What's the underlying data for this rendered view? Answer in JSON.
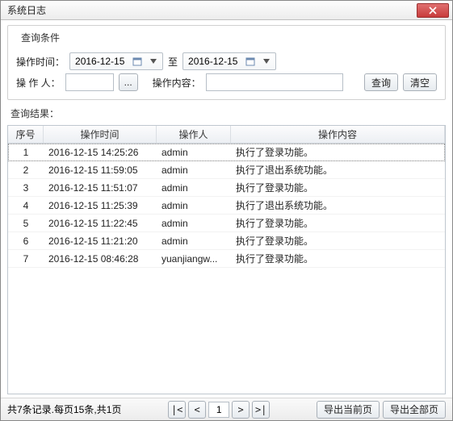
{
  "window": {
    "title": "系统日志"
  },
  "query": {
    "legend": "查询条件",
    "time_label": "操作时间：",
    "to_label": "至",
    "date_from": "2016-12-15",
    "date_to": "2016-12-15",
    "operator_label": "操 作 人：",
    "operator_value": "",
    "content_label": "操作内容：",
    "content_value": "",
    "search_btn": "查询",
    "clear_btn": "清空",
    "ellipsis": "..."
  },
  "result": {
    "label": "查询结果：",
    "columns": {
      "idx": "序号",
      "time": "操作时间",
      "user": "操作人",
      "content": "操作内容"
    },
    "rows": [
      {
        "idx": "1",
        "time": "2016-12-15 14:25:26",
        "user": "admin",
        "content": "执行了登录功能。"
      },
      {
        "idx": "2",
        "time": "2016-12-15 11:59:05",
        "user": "admin",
        "content": "执行了退出系统功能。"
      },
      {
        "idx": "3",
        "time": "2016-12-15 11:51:07",
        "user": "admin",
        "content": "执行了登录功能。"
      },
      {
        "idx": "4",
        "time": "2016-12-15 11:25:39",
        "user": "admin",
        "content": "执行了退出系统功能。"
      },
      {
        "idx": "5",
        "time": "2016-12-15 11:22:45",
        "user": "admin",
        "content": "执行了登录功能。"
      },
      {
        "idx": "6",
        "time": "2016-12-15 11:21:20",
        "user": "admin",
        "content": "执行了登录功能。"
      },
      {
        "idx": "7",
        "time": "2016-12-15 08:46:28",
        "user": "yuanjiangw...",
        "content": "执行了登录功能。"
      }
    ]
  },
  "footer": {
    "summary": "共7条记录.每页15条,共1页",
    "first": "|<",
    "prev": "<",
    "next": ">",
    "last": ">|",
    "page": "1",
    "export_page": "导出当前页",
    "export_all": "导出全部页"
  }
}
